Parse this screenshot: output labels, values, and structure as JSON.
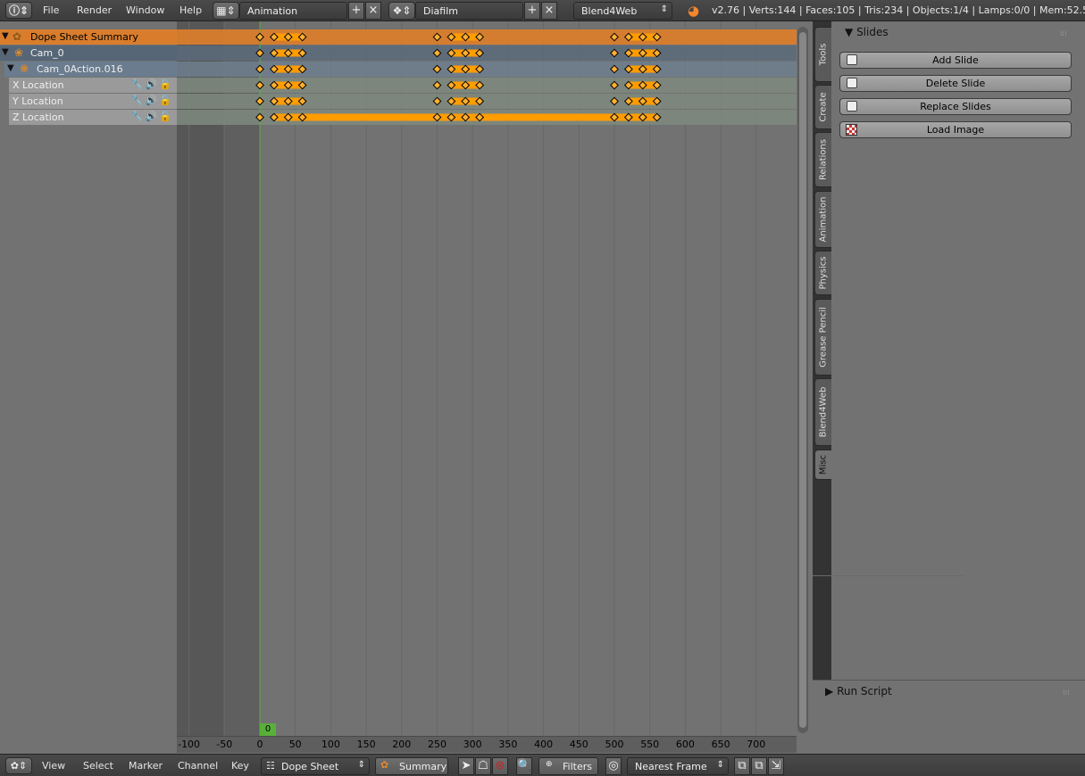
{
  "header": {
    "menus": [
      "File",
      "Render",
      "Window",
      "Help"
    ],
    "screen_layout": "Animation",
    "scene": "Diafilm",
    "render_engine": "Blend4Web",
    "stats": "v2.76 | Verts:144 | Faces:105 | Tris:234 | Objects:1/4 | Lamps:0/0 | Mem:52.59M"
  },
  "channels": [
    {
      "label": "Dope Sheet Summary",
      "kind": "summary"
    },
    {
      "label": "Cam_0",
      "kind": "object"
    },
    {
      "label": "Cam_0Action.016",
      "kind": "action"
    },
    {
      "label": "X Location",
      "kind": "fcurve"
    },
    {
      "label": "Y Location",
      "kind": "fcurve"
    },
    {
      "label": "Z Location",
      "kind": "fcurve"
    }
  ],
  "keyframes": [
    0,
    20,
    40,
    60,
    250,
    270,
    290,
    310,
    500,
    520,
    540,
    560
  ],
  "hold_ranges": [
    [
      20,
      60
    ],
    [
      270,
      310
    ],
    [
      520,
      560
    ]
  ],
  "current_frame": "0",
  "ruler_ticks": [
    "-100",
    "-50",
    "0",
    "50",
    "100",
    "150",
    "200",
    "250",
    "300",
    "350",
    "400",
    "450",
    "500",
    "550",
    "600",
    "650",
    "700"
  ],
  "tabs": [
    "Tools",
    "Create",
    "Relations",
    "Animation",
    "Physics",
    "Grease Pencil",
    "Blend4Web",
    "Misc"
  ],
  "active_tab": "Misc",
  "slides_panel": {
    "title": "Slides",
    "buttons": [
      "Add Slide",
      "Delete Slide",
      "Replace Slides",
      "Load Image"
    ]
  },
  "run_script_panel": {
    "title": "Run Script"
  },
  "footer": {
    "menus": [
      "View",
      "Select",
      "Marker",
      "Channel",
      "Key"
    ],
    "mode": "Dope Sheet",
    "summary": "Summary",
    "filters": "Filters",
    "snap": "Nearest Frame"
  },
  "colors": {
    "keyframe": "#ff9c00",
    "summary_row": "#d97d2c",
    "current_frame": "#58b038"
  }
}
